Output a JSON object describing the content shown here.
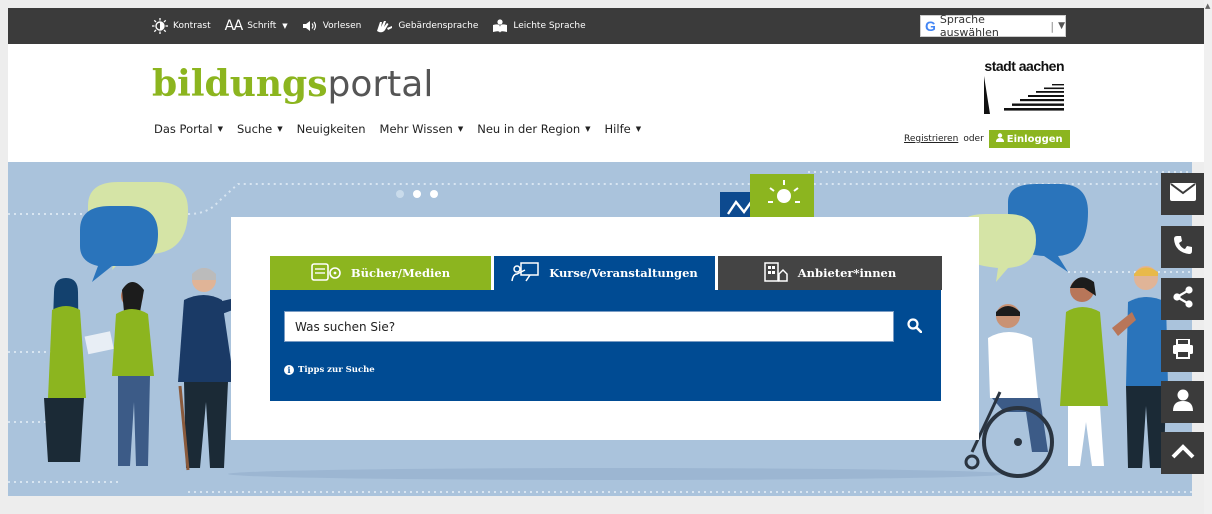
{
  "topbar": {
    "tools": [
      {
        "icon": "contrast-icon",
        "label": "Kontrast"
      },
      {
        "icon": "font-size-icon",
        "label": "Schrift",
        "caret": true
      },
      {
        "icon": "speaker-icon",
        "label": "Vorlesen"
      },
      {
        "icon": "sign-language-icon",
        "label": "Gebärdensprache"
      },
      {
        "icon": "easy-language-icon",
        "label": "Leichte Sprache"
      }
    ],
    "font_glyph": "AA",
    "translate": {
      "label": "Sprache auswählen",
      "g": "G"
    }
  },
  "header": {
    "logo": {
      "part1": "bildungs",
      "part2": "portal"
    },
    "city_logo": "stadt aachen",
    "nav": [
      {
        "label": "Das Portal",
        "caret": true
      },
      {
        "label": "Suche",
        "caret": true
      },
      {
        "label": "Neuigkeiten",
        "caret": false
      },
      {
        "label": "Mehr Wissen",
        "caret": true
      },
      {
        "label": "Neu in der Region",
        "caret": true
      },
      {
        "label": "Hilfe",
        "caret": true
      }
    ],
    "register": "Registrieren",
    "or": "oder",
    "login": "Einloggen"
  },
  "search": {
    "tabs": [
      {
        "label": "Bücher/Medien",
        "icon": "media-icon",
        "active": false
      },
      {
        "label": "Kurse/Veranstaltungen",
        "icon": "presentation-icon",
        "active": true
      },
      {
        "label": "Anbieter*innen",
        "icon": "building-icon",
        "active": false
      }
    ],
    "placeholder": "Was suchen Sie?",
    "tips": "Tipps zur Suche"
  },
  "sidebar": [
    {
      "icon": "mail-icon"
    },
    {
      "icon": "phone-icon"
    },
    {
      "icon": "share-icon"
    },
    {
      "icon": "print-icon"
    },
    {
      "icon": "user-icon"
    },
    {
      "icon": "scroll-top-icon"
    }
  ],
  "colors": {
    "green": "#8cb51f",
    "blue": "#004b93",
    "dark": "#3b3b3b",
    "hero": "#aac3dc"
  }
}
